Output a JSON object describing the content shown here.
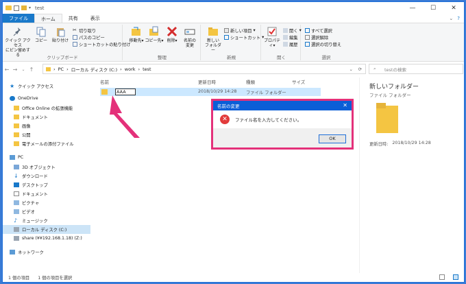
{
  "window": {
    "title": "test"
  },
  "menubar": {
    "tabs": [
      "ファイル",
      "ホーム",
      "共有",
      "表示"
    ]
  },
  "ribbon": {
    "clipboard": {
      "label": "クリップボード",
      "pin": "クイック アクセス\nにピン留めする",
      "copy": "コピー",
      "paste": "貼り付け",
      "cut": "切り取り",
      "copy_path": "パスのコピー",
      "paste_shortcut": "ショートカットの貼り付け"
    },
    "organize": {
      "label": "整理",
      "move": "移動先",
      "copyto": "コピー先",
      "delete": "削除",
      "rename": "名前の\n変更"
    },
    "new": {
      "label": "新規",
      "new_folder": "新しい\nフォルダー",
      "new_item": "新しい項目",
      "shortcut": "ショートカット"
    },
    "open": {
      "label": "開く",
      "properties": "プロパティ",
      "open": "開く",
      "edit": "編集",
      "history": "履歴"
    },
    "select": {
      "label": "選択",
      "select_all": "すべて選択",
      "select_none": "選択解除",
      "invert": "選択の切り替え"
    }
  },
  "address": {
    "crumbs": [
      "PC",
      "ローカル ディスク (C:)",
      "work",
      "test"
    ],
    "search_placeholder": "testの検索"
  },
  "nav": {
    "quick_access": "クイック アクセス",
    "onedrive": "OneDrive",
    "onedrive_items": [
      "Office Online の拡張機能",
      "ドキュメント",
      "画像",
      "公開",
      "電子メールの添付ファイル"
    ],
    "pc": "PC",
    "pc_items": [
      "3D オブジェクト",
      "ダウンロード",
      "デスクトップ",
      "ドキュメント",
      "ピクチャ",
      "ビデオ",
      "ミュージック",
      "ローカル ディスク (C:)",
      "share (¥¥192.168.1.18) (Z:)"
    ],
    "network": "ネットワーク"
  },
  "columns": {
    "name": "名前",
    "date": "更新日時",
    "type": "種類",
    "size": "サイズ"
  },
  "file": {
    "name": "AAA",
    "date": "2018/10/29 14:28",
    "type": "ファイル フォルダー"
  },
  "preview": {
    "title": "新しいフォルダー",
    "subtitle": "ファイル フォルダー",
    "date_label": "更新日時:",
    "date": "2018/10/29 14:28"
  },
  "dialog": {
    "title": "名前の変更",
    "message": "ファイル名を入力してください。",
    "ok": "OK"
  },
  "status": {
    "count": "1 個の項目",
    "selected": "1 個の項目を選択"
  },
  "colors": {
    "accent": "#1979ca",
    "dialog_title": "#0b5ed7",
    "highlight": "#e4317a",
    "folder": "#f4c542"
  }
}
